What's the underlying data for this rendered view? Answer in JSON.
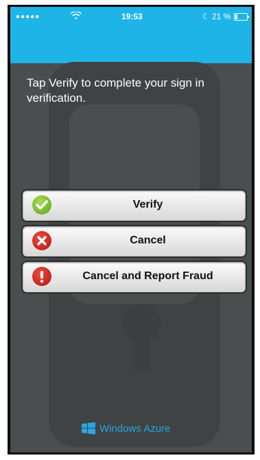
{
  "status_bar": {
    "signal": "●●●●●",
    "time": "19:53",
    "battery_percent": "21 %",
    "battery_level": 0.21
  },
  "instruction": "Tap Verify to complete your sign in verification.",
  "buttons": {
    "verify": "Verify",
    "cancel": "Cancel",
    "report_fraud": "Cancel and Report Fraud"
  },
  "footer": {
    "brand": "Windows Azure"
  },
  "colors": {
    "accent": "#1fb4e8",
    "background": "#4a4e4f",
    "brand": "#2aa7e0"
  }
}
